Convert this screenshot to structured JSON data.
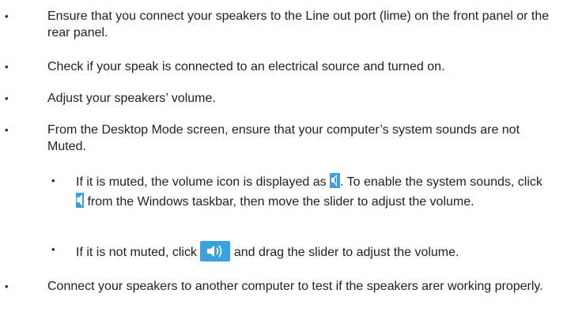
{
  "list": {
    "items": [
      {
        "text": "Ensure that you connect your speakers to the Line out port (lime) on the front panel or the rear panel."
      },
      {
        "text": "Check if your speak is connected to an electrical source and turned on."
      },
      {
        "text": "Adjust your speakers’ volume."
      },
      {
        "text": "From the Desktop Mode screen, ensure that your computer’s system sounds are not Muted."
      }
    ],
    "sub_items": [
      {
        "part1": "If it is muted, the volume icon is displayed as",
        "part2": ". To enable the system sounds, click",
        "part3": "from the Windows taskbar, then move the slider to adjust the volume.",
        "icon_muted": "muted-speaker-icon",
        "icon_taskbar": "taskbar-speaker-icon"
      },
      {
        "part1": "If it is not muted, click",
        "part2": "and drag the slider to adjust the volume.",
        "icon_volume": "volume-button-icon"
      }
    ],
    "last_item": {
      "text": "Connect your speakers to another computer to test if the speakers arer working properly."
    },
    "bullet": "•"
  },
  "colors": {
    "text": "#222222",
    "icon_bg": "#3aa0e0",
    "icon_dark": "#ffffff"
  }
}
